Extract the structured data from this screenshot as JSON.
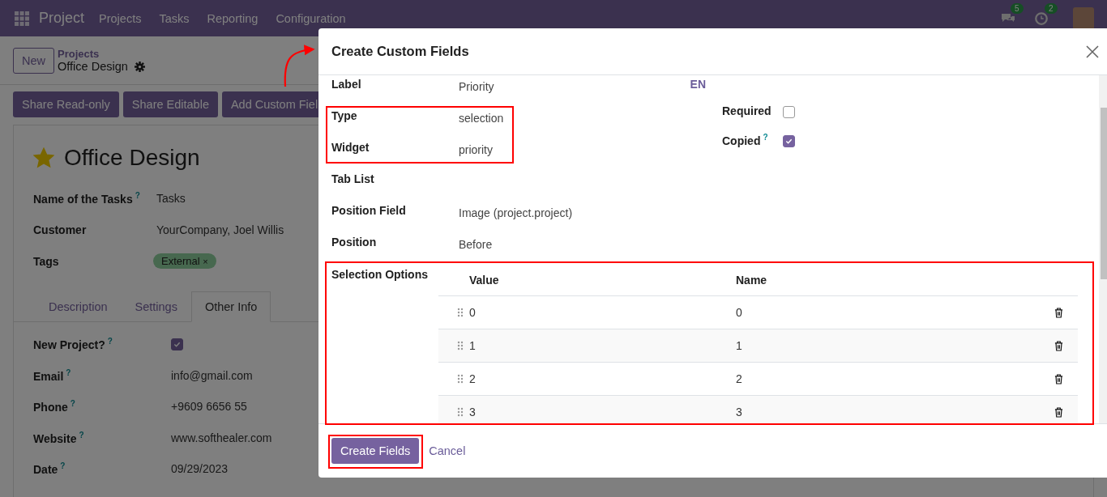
{
  "navbar": {
    "app": "Project",
    "menu": [
      "Projects",
      "Tasks",
      "Reporting",
      "Configuration"
    ],
    "messages_badge": "5",
    "activities_badge": "2"
  },
  "control_panel": {
    "new_button": "New",
    "breadcrumb": "Projects",
    "record": "Office Design",
    "actions": [
      "Share Read-only",
      "Share Editable",
      "Add Custom Fiel"
    ]
  },
  "form": {
    "title": "Office Design",
    "favorite": true,
    "fields": [
      {
        "kind": "text",
        "label": "Name of the Tasks",
        "help": "?",
        "value": "Tasks"
      },
      {
        "kind": "text",
        "label": "Customer",
        "value": "YourCompany, Joel Willis"
      },
      {
        "kind": "tag",
        "label": "Tags",
        "value": "External",
        "remove": "×"
      }
    ],
    "tabs": [
      {
        "label": "Description",
        "selected": false
      },
      {
        "label": "Settings",
        "selected": false
      },
      {
        "label": "Other Info",
        "selected": true
      }
    ],
    "tab_fields": [
      {
        "kind": "checkbox",
        "label": "New Project?",
        "help": "?",
        "checked": true
      },
      {
        "kind": "text",
        "label": "Email",
        "help": "?",
        "value": "info@gmail.com"
      },
      {
        "kind": "text",
        "label": "Phone",
        "help": "?",
        "value": "+9609 6656 55"
      },
      {
        "kind": "text",
        "label": "Website",
        "help": "?",
        "value": "www.softhealer.com"
      },
      {
        "kind": "text",
        "label": "Date",
        "help": "?",
        "value": "09/29/2023"
      }
    ]
  },
  "dialog": {
    "title": "Create Custom Fields",
    "fields": [
      {
        "label": "Label",
        "value": "Priority",
        "lang": "EN"
      },
      {
        "label": "Type",
        "value": "selection"
      },
      {
        "label": "Widget",
        "value": "priority"
      },
      {
        "label": "Tab List"
      },
      {
        "label": "Position Field",
        "value": "Image (project.project)"
      },
      {
        "label": "Position",
        "value": "Before"
      }
    ],
    "toggles": [
      {
        "label": "Required",
        "checked": false
      },
      {
        "label": "Copied",
        "help": "?",
        "checked": true
      }
    ],
    "selection_options": {
      "label": "Selection Options",
      "columns": [
        "Value",
        "Name"
      ],
      "rows": [
        {
          "value": "0",
          "name": "0"
        },
        {
          "value": "1",
          "name": "1"
        },
        {
          "value": "2",
          "name": "2"
        },
        {
          "value": "3",
          "name": "3"
        }
      ]
    },
    "buttons": [
      {
        "kind": "primary",
        "label": "Create Fields"
      },
      {
        "kind": "link",
        "label": "Cancel"
      }
    ]
  }
}
